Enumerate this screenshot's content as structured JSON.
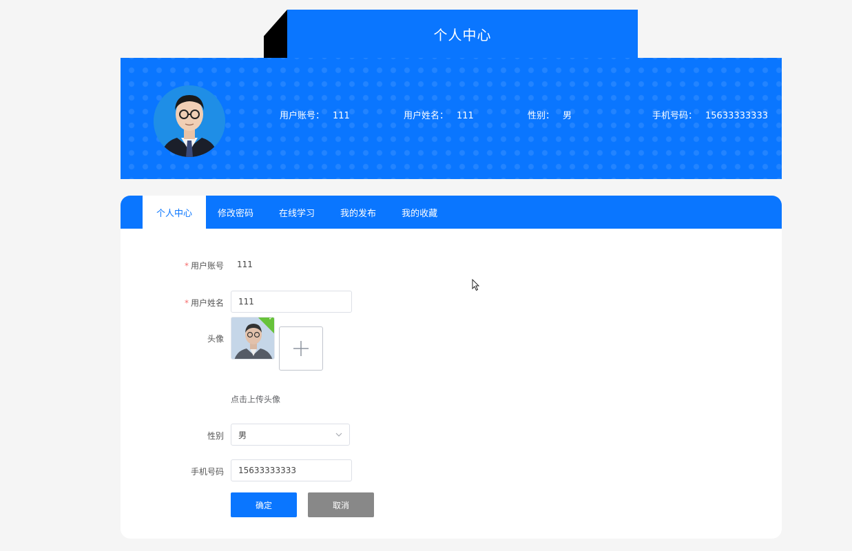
{
  "header": {
    "title": "个人中心"
  },
  "profile": {
    "account_label": "用户账号：",
    "account_value": "111",
    "name_label": "用户姓名：",
    "name_value": "111",
    "gender_label": "性别：",
    "gender_value": "男",
    "phone_label": "手机号码：",
    "phone_value": "15633333333"
  },
  "tabs": [
    {
      "label": "个人中心",
      "active": true
    },
    {
      "label": "修改密码",
      "active": false
    },
    {
      "label": "在线学习",
      "active": false
    },
    {
      "label": "我的发布",
      "active": false
    },
    {
      "label": "我的收藏",
      "active": false
    }
  ],
  "form": {
    "required_mark": "*",
    "account": {
      "label": "用户账号",
      "value": "111"
    },
    "name": {
      "label": "用户姓名",
      "value": "111"
    },
    "avatar": {
      "label": "头像",
      "hint": "点击上传头像",
      "upload_icon": "plus-icon",
      "uploaded_icon": "check-icon"
    },
    "gender": {
      "label": "性别",
      "value": "男",
      "icon": "chevron-down-icon"
    },
    "phone": {
      "label": "手机号码",
      "value": "15633333333"
    },
    "confirm_label": "确定",
    "cancel_label": "取消"
  },
  "colors": {
    "primary": "#0a76ff",
    "cancel": "#888888",
    "required": "#f56c6c",
    "success": "#67c23a"
  }
}
